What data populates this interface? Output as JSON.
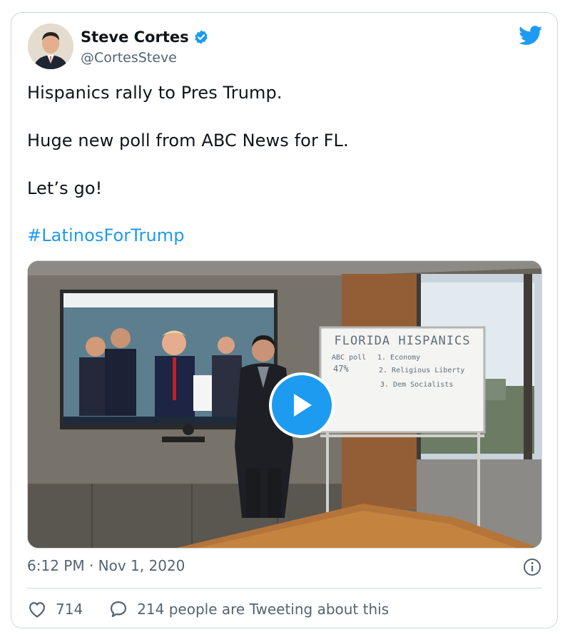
{
  "author": {
    "display_name": "Steve Cortes",
    "handle": "@CortesSteve",
    "verified": true
  },
  "tweet": {
    "line1": "Hispanics rally to Pres Trump.",
    "line2": "Huge new poll from ABC News for FL.",
    "line3": "Let’s go!",
    "hashtag": "#LatinosForTrump"
  },
  "media": {
    "type": "video",
    "whiteboard": {
      "title": "FLORIDA HISPANICS",
      "left_note_1": "ABC poll",
      "left_note_2": "47%",
      "item_1": "1. Economy",
      "item_2": "2. Religious Liberty",
      "item_3": "3. Dem Socialists"
    }
  },
  "meta": {
    "timestamp": "6:12 PM · Nov 1, 2020"
  },
  "actions": {
    "likes": "714",
    "conversation": "214 people are Tweeting about this"
  },
  "colors": {
    "accent": "#1d9bf0",
    "text": "#0f1419",
    "secondary": "#536471",
    "border": "#cfd9de"
  }
}
